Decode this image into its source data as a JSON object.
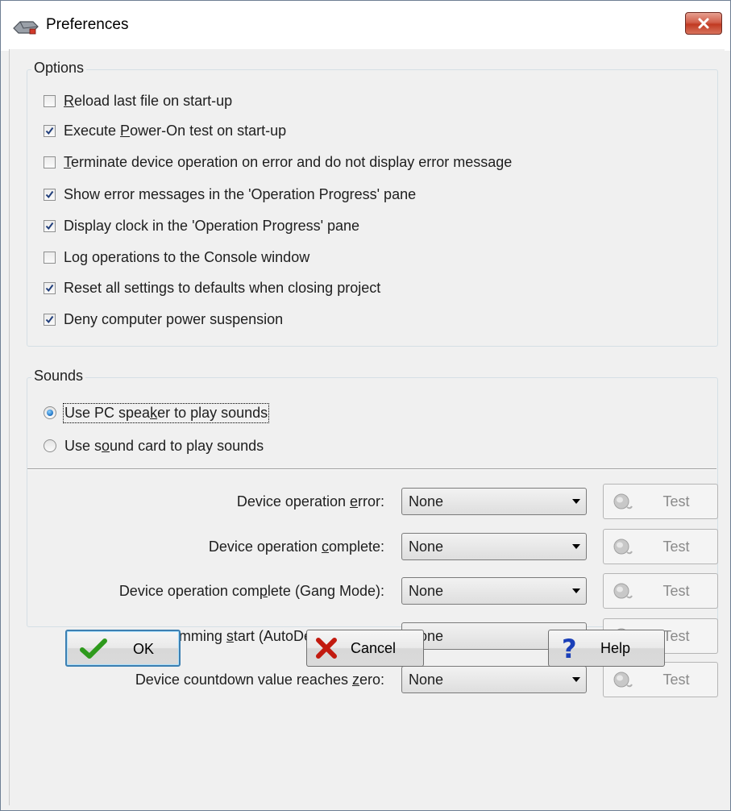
{
  "window": {
    "title": "Preferences"
  },
  "options": {
    "label": "Options",
    "items": [
      {
        "label": "Reload last file on start-up",
        "checked": false
      },
      {
        "label": "Execute Power-On test on start-up",
        "checked": true
      },
      {
        "label": "Terminate device operation on error and do not display error message",
        "checked": false
      },
      {
        "label": "Show error messages in the 'Operation Progress' pane",
        "checked": true
      },
      {
        "label": "Display clock in the 'Operation Progress' pane",
        "checked": true
      },
      {
        "label": "Log operations to the Console window",
        "checked": false
      },
      {
        "label": "Reset all settings to defaults when closing project",
        "checked": true
      },
      {
        "label": "Deny computer power suspension",
        "checked": true
      }
    ]
  },
  "sounds": {
    "label": "Sounds",
    "radios": [
      {
        "label": "Use PC speaker to play sounds",
        "selected": true
      },
      {
        "label": "Use sound card to play sounds",
        "selected": false
      }
    ],
    "events": [
      {
        "label": "Device operation error:",
        "value": "None",
        "test_label": "Test"
      },
      {
        "label": "Device operation complete:",
        "value": "None",
        "test_label": "Test"
      },
      {
        "label": "Device operation complete (Gang Mode):",
        "value": "None",
        "test_label": "Test"
      },
      {
        "label": "Programming start (AutoDetect Mode):",
        "value": "None",
        "test_label": "Test"
      },
      {
        "label": "Device countdown value reaches zero:",
        "value": "None",
        "test_label": "Test"
      }
    ]
  },
  "buttons": {
    "ok": "OK",
    "cancel": "Cancel",
    "help": "Help"
  },
  "colors": {
    "ok_check": "#2e9a1c",
    "cancel_x": "#c21a0f",
    "help_q": "#1a3fb8",
    "radio_dot": "#1b6fc2"
  }
}
